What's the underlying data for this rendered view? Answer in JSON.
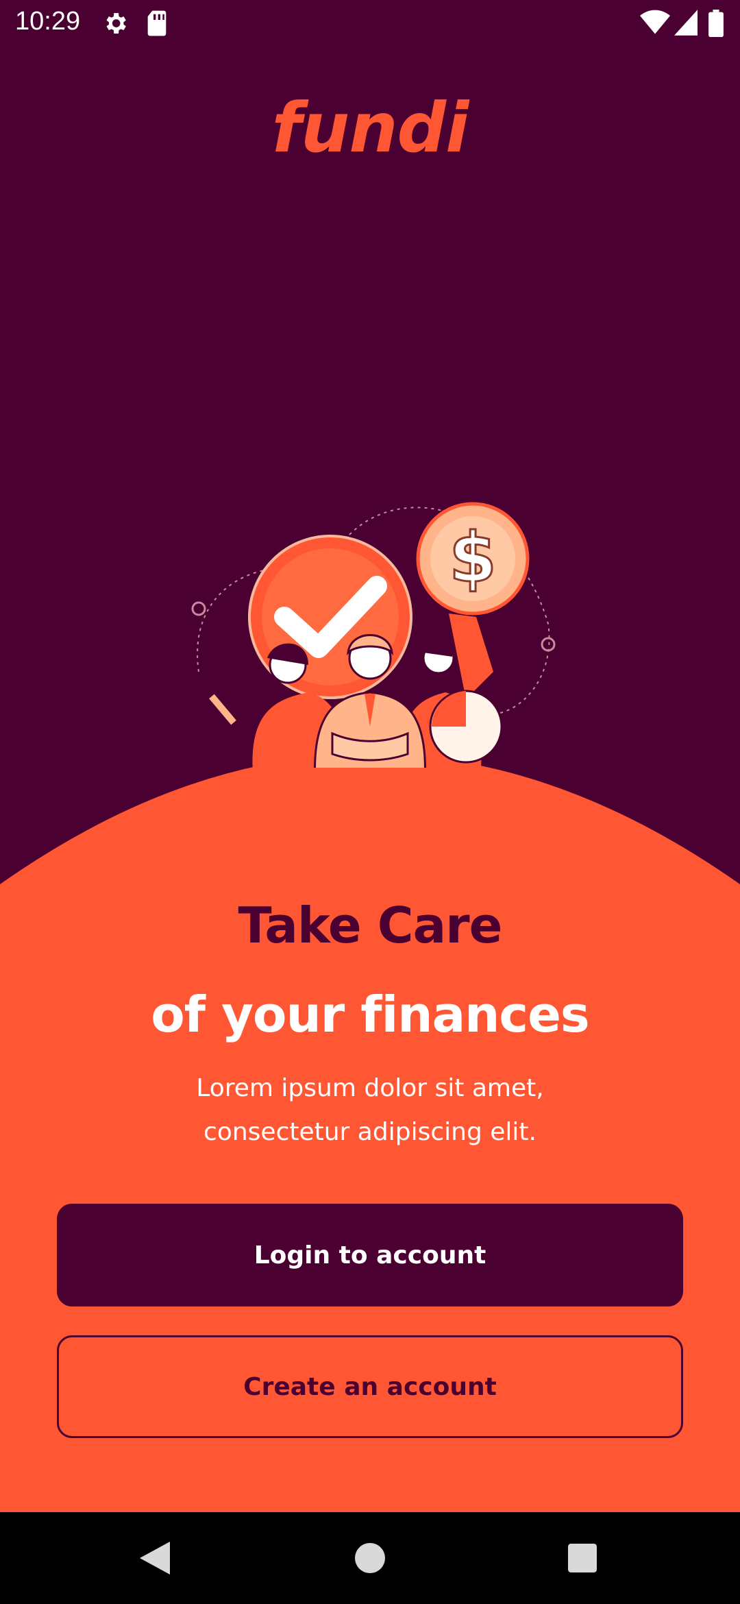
{
  "status_bar": {
    "time": "10:29",
    "icons": [
      "settings-icon",
      "sd-card-icon",
      "wifi-icon",
      "cell-signal-icon",
      "battery-icon"
    ]
  },
  "app": {
    "logo_text": "fundi"
  },
  "hero": {
    "headline_line1": "Take Care",
    "headline_line2": "of your finances",
    "subtitle_line1": "Lorem ipsum dolor sit amet,",
    "subtitle_line2": "consectetur adipiscing elit."
  },
  "actions": {
    "login_label": "Login to account",
    "create_label": "Create an account"
  },
  "navigation": {
    "icons": [
      "back-icon",
      "home-icon",
      "recents-icon"
    ]
  },
  "colors": {
    "background": "#4a0030",
    "accent": "#ff5733",
    "white": "#ffffff"
  }
}
